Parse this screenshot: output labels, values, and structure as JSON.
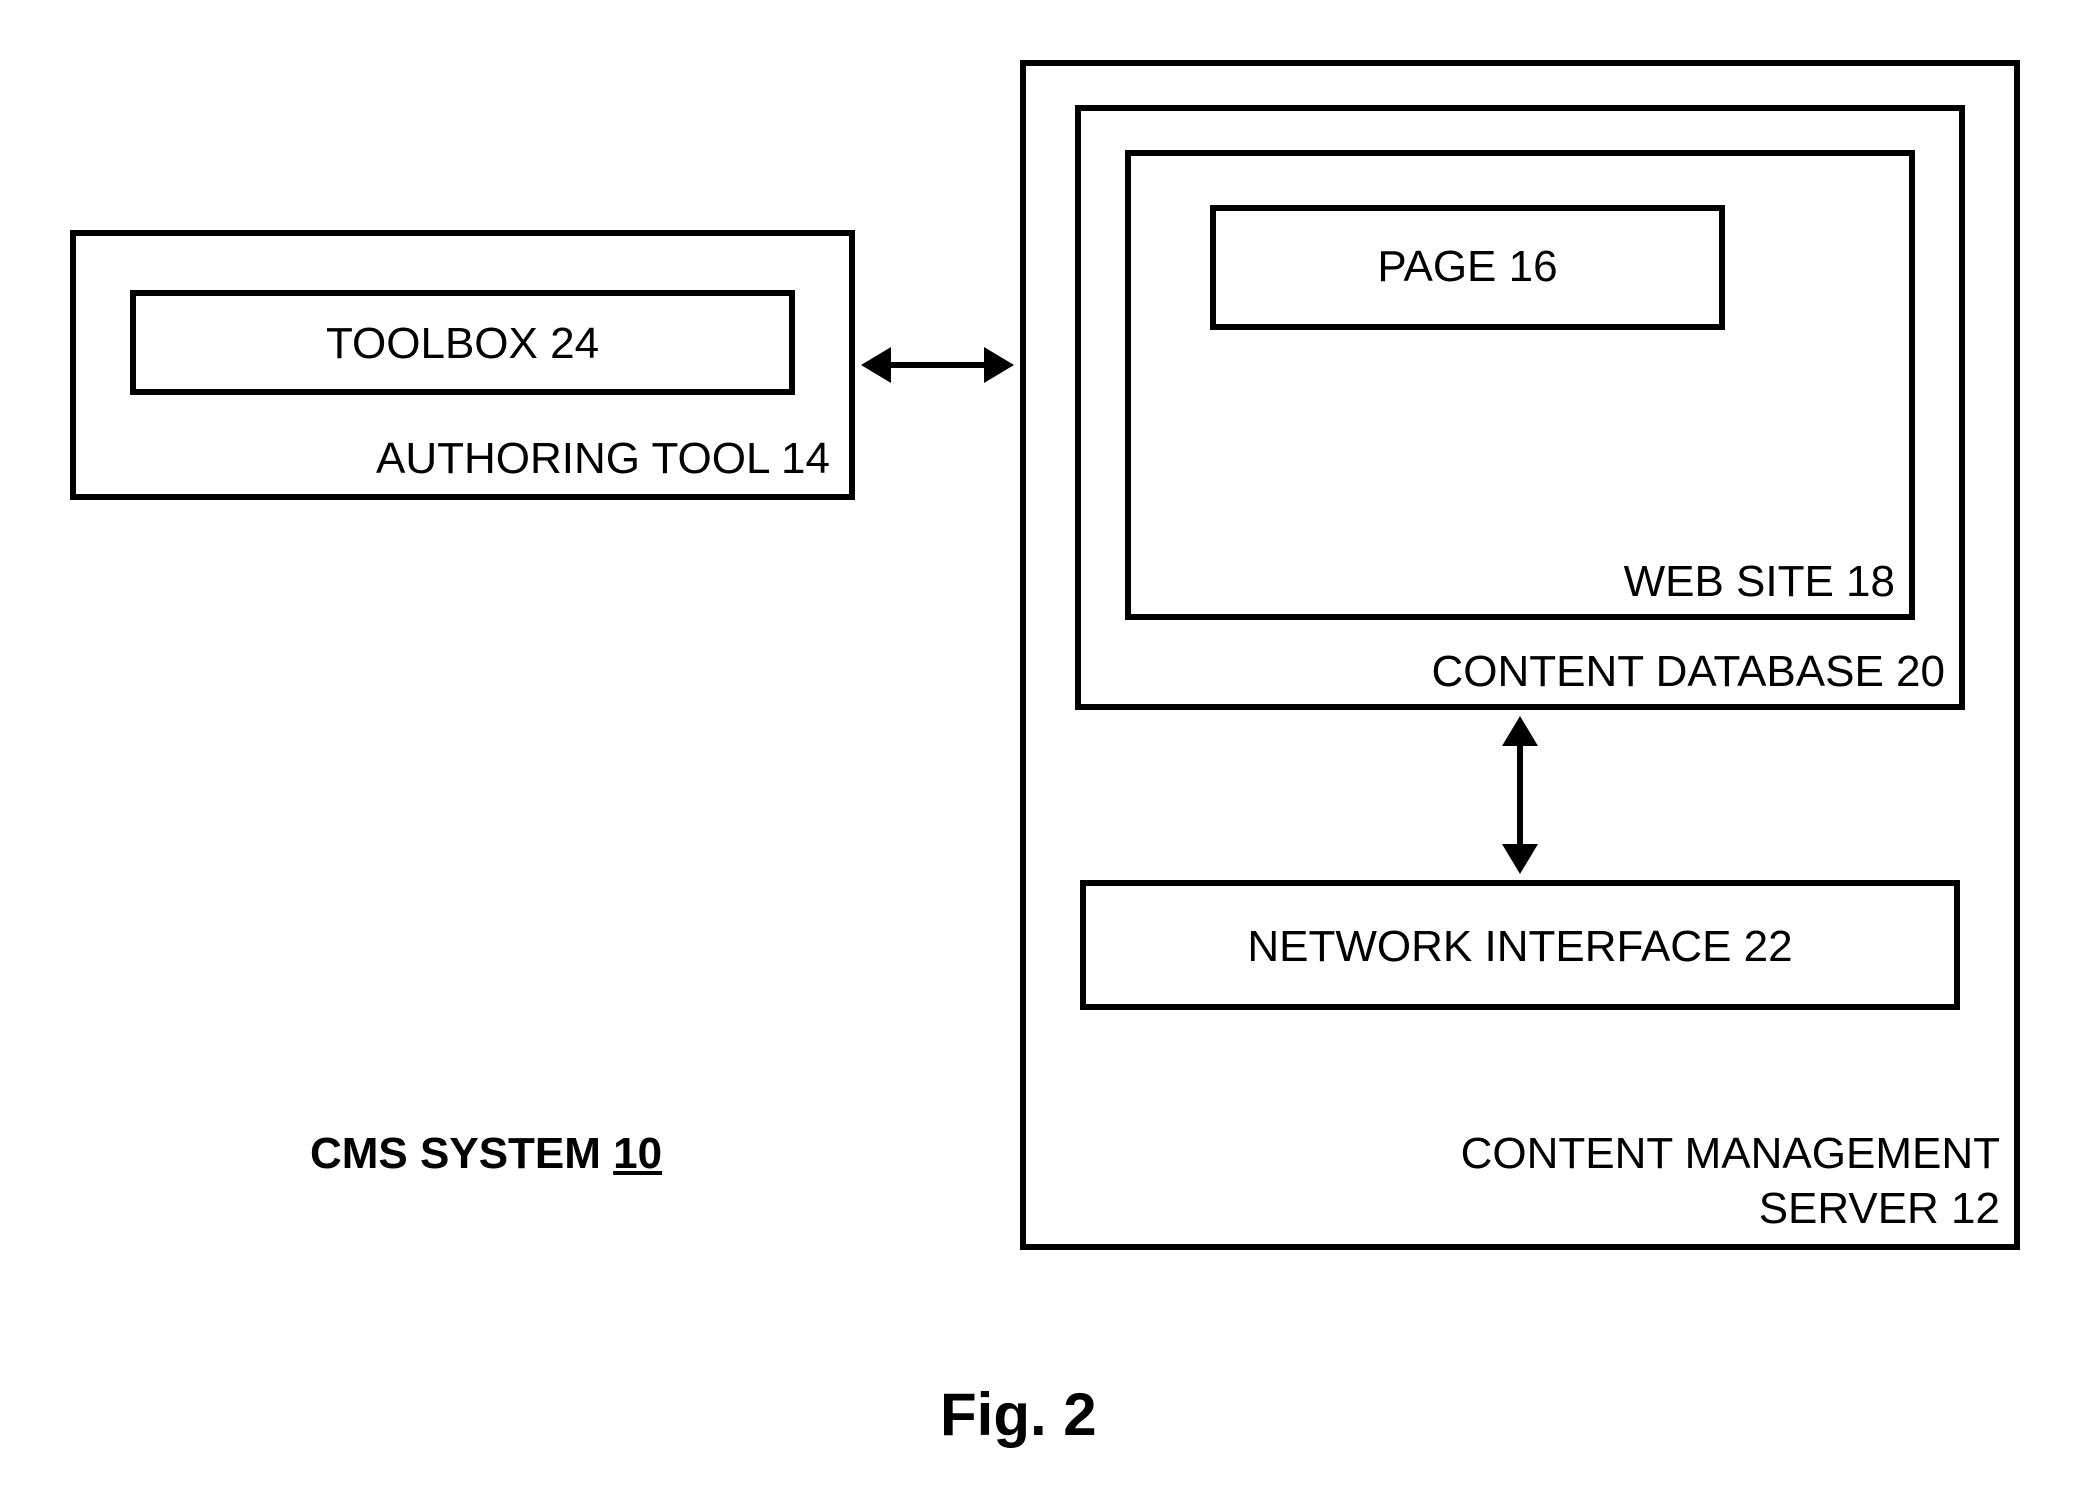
{
  "diagram": {
    "title": "CMS SYSTEM",
    "title_ref": "10",
    "figure": "Fig. 2",
    "authoring_tool": {
      "label": "AUTHORING TOOL 14",
      "toolbox": "TOOLBOX 24"
    },
    "server": {
      "label_line1": "CONTENT MANAGEMENT",
      "label_line2": "SERVER 12",
      "content_database": {
        "label": "CONTENT DATABASE 20",
        "web_site": {
          "label": "WEB SITE 18",
          "page": "PAGE 16"
        }
      },
      "network_interface": "NETWORK INTERFACE 22"
    }
  }
}
